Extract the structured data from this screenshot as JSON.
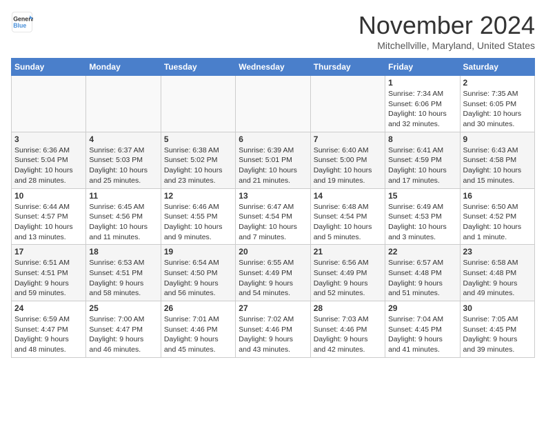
{
  "logo": {
    "general": "General",
    "blue": "Blue"
  },
  "title": "November 2024",
  "subtitle": "Mitchellville, Maryland, United States",
  "days_of_week": [
    "Sunday",
    "Monday",
    "Tuesday",
    "Wednesday",
    "Thursday",
    "Friday",
    "Saturday"
  ],
  "weeks": [
    [
      {
        "day": "",
        "info": ""
      },
      {
        "day": "",
        "info": ""
      },
      {
        "day": "",
        "info": ""
      },
      {
        "day": "",
        "info": ""
      },
      {
        "day": "",
        "info": ""
      },
      {
        "day": "1",
        "info": "Sunrise: 7:34 AM\nSunset: 6:06 PM\nDaylight: 10 hours\nand 32 minutes."
      },
      {
        "day": "2",
        "info": "Sunrise: 7:35 AM\nSunset: 6:05 PM\nDaylight: 10 hours\nand 30 minutes."
      }
    ],
    [
      {
        "day": "3",
        "info": "Sunrise: 6:36 AM\nSunset: 5:04 PM\nDaylight: 10 hours\nand 28 minutes."
      },
      {
        "day": "4",
        "info": "Sunrise: 6:37 AM\nSunset: 5:03 PM\nDaylight: 10 hours\nand 25 minutes."
      },
      {
        "day": "5",
        "info": "Sunrise: 6:38 AM\nSunset: 5:02 PM\nDaylight: 10 hours\nand 23 minutes."
      },
      {
        "day": "6",
        "info": "Sunrise: 6:39 AM\nSunset: 5:01 PM\nDaylight: 10 hours\nand 21 minutes."
      },
      {
        "day": "7",
        "info": "Sunrise: 6:40 AM\nSunset: 5:00 PM\nDaylight: 10 hours\nand 19 minutes."
      },
      {
        "day": "8",
        "info": "Sunrise: 6:41 AM\nSunset: 4:59 PM\nDaylight: 10 hours\nand 17 minutes."
      },
      {
        "day": "9",
        "info": "Sunrise: 6:43 AM\nSunset: 4:58 PM\nDaylight: 10 hours\nand 15 minutes."
      }
    ],
    [
      {
        "day": "10",
        "info": "Sunrise: 6:44 AM\nSunset: 4:57 PM\nDaylight: 10 hours\nand 13 minutes."
      },
      {
        "day": "11",
        "info": "Sunrise: 6:45 AM\nSunset: 4:56 PM\nDaylight: 10 hours\nand 11 minutes."
      },
      {
        "day": "12",
        "info": "Sunrise: 6:46 AM\nSunset: 4:55 PM\nDaylight: 10 hours\nand 9 minutes."
      },
      {
        "day": "13",
        "info": "Sunrise: 6:47 AM\nSunset: 4:54 PM\nDaylight: 10 hours\nand 7 minutes."
      },
      {
        "day": "14",
        "info": "Sunrise: 6:48 AM\nSunset: 4:54 PM\nDaylight: 10 hours\nand 5 minutes."
      },
      {
        "day": "15",
        "info": "Sunrise: 6:49 AM\nSunset: 4:53 PM\nDaylight: 10 hours\nand 3 minutes."
      },
      {
        "day": "16",
        "info": "Sunrise: 6:50 AM\nSunset: 4:52 PM\nDaylight: 10 hours\nand 1 minute."
      }
    ],
    [
      {
        "day": "17",
        "info": "Sunrise: 6:51 AM\nSunset: 4:51 PM\nDaylight: 9 hours\nand 59 minutes."
      },
      {
        "day": "18",
        "info": "Sunrise: 6:53 AM\nSunset: 4:51 PM\nDaylight: 9 hours\nand 58 minutes."
      },
      {
        "day": "19",
        "info": "Sunrise: 6:54 AM\nSunset: 4:50 PM\nDaylight: 9 hours\nand 56 minutes."
      },
      {
        "day": "20",
        "info": "Sunrise: 6:55 AM\nSunset: 4:49 PM\nDaylight: 9 hours\nand 54 minutes."
      },
      {
        "day": "21",
        "info": "Sunrise: 6:56 AM\nSunset: 4:49 PM\nDaylight: 9 hours\nand 52 minutes."
      },
      {
        "day": "22",
        "info": "Sunrise: 6:57 AM\nSunset: 4:48 PM\nDaylight: 9 hours\nand 51 minutes."
      },
      {
        "day": "23",
        "info": "Sunrise: 6:58 AM\nSunset: 4:48 PM\nDaylight: 9 hours\nand 49 minutes."
      }
    ],
    [
      {
        "day": "24",
        "info": "Sunrise: 6:59 AM\nSunset: 4:47 PM\nDaylight: 9 hours\nand 48 minutes."
      },
      {
        "day": "25",
        "info": "Sunrise: 7:00 AM\nSunset: 4:47 PM\nDaylight: 9 hours\nand 46 minutes."
      },
      {
        "day": "26",
        "info": "Sunrise: 7:01 AM\nSunset: 4:46 PM\nDaylight: 9 hours\nand 45 minutes."
      },
      {
        "day": "27",
        "info": "Sunrise: 7:02 AM\nSunset: 4:46 PM\nDaylight: 9 hours\nand 43 minutes."
      },
      {
        "day": "28",
        "info": "Sunrise: 7:03 AM\nSunset: 4:46 PM\nDaylight: 9 hours\nand 42 minutes."
      },
      {
        "day": "29",
        "info": "Sunrise: 7:04 AM\nSunset: 4:45 PM\nDaylight: 9 hours\nand 41 minutes."
      },
      {
        "day": "30",
        "info": "Sunrise: 7:05 AM\nSunset: 4:45 PM\nDaylight: 9 hours\nand 39 minutes."
      }
    ]
  ]
}
